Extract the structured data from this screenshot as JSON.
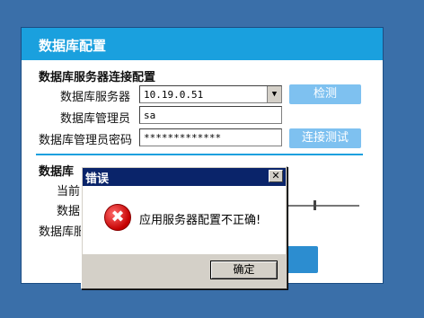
{
  "panel": {
    "title": "数据库配置",
    "connection_section": {
      "title": "数据库服务器连接配置",
      "server_label": "数据库服务器",
      "server_value": "10.19.0.51",
      "admin_label": "数据库管理员",
      "admin_value": "sa",
      "password_label": "数据库管理员密码",
      "password_value": "*************",
      "detect_button": "检测",
      "test_button": "连接测试"
    },
    "second_section": {
      "title_partial": "数据库",
      "row1_partial": "当前",
      "row2_partial": "数据",
      "row3_partial": "数据库服"
    }
  },
  "dialog": {
    "title": "错误",
    "close_glyph": "✕",
    "icon_glyph": "✖",
    "message": "应用服务器配置不正确!",
    "ok_button": "确定"
  }
}
